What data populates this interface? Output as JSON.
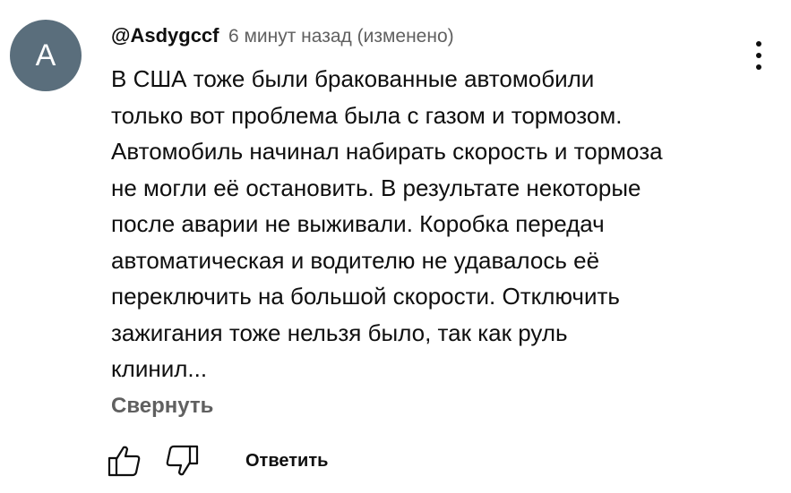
{
  "comment": {
    "avatar_letter": "A",
    "author": "@Asdygccf",
    "timestamp": "6 минут назад (изменено)",
    "text_lines": [
      "В США тоже были бракованные автомобили",
      "только вот проблема была с газом и тормозом.",
      "Автомобиль начинал набирать скорость и тормоза",
      "не могли её остановить. В результате некоторые",
      "после аварии не выживали. Коробка передач",
      "автоматическая и водителю не удавалось её",
      "переключить на большой скорости. Отключить",
      "зажигания тоже нельзя было, так как руль",
      "клинил..."
    ],
    "collapse_label": "Свернуть",
    "reply_label": "Ответить"
  },
  "icons": {
    "more": "more-vert-icon",
    "like": "thumbs-up-icon",
    "dislike": "thumbs-down-icon"
  },
  "colors": {
    "avatar_bg": "#5a6e7c",
    "secondary_text": "#606060",
    "primary_text": "#0f0f0f"
  }
}
